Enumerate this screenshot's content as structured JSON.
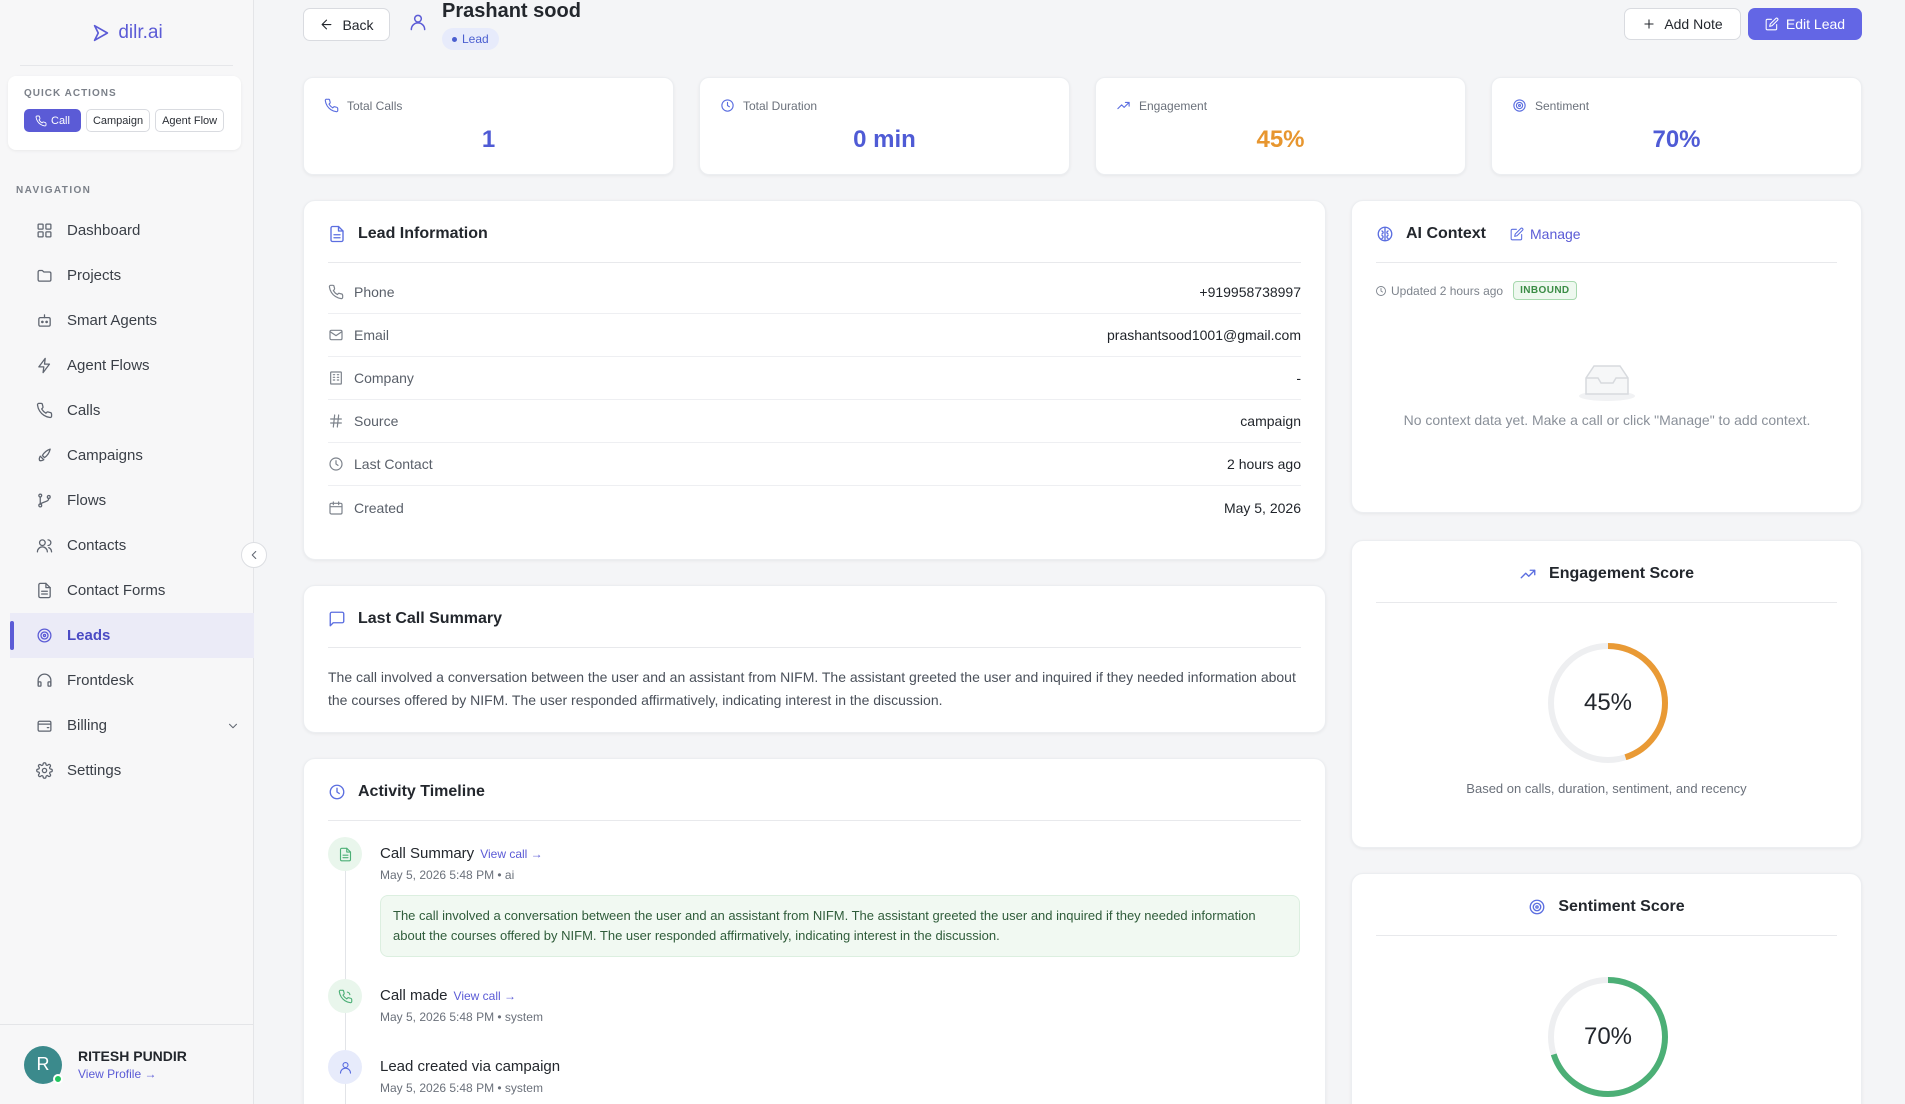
{
  "app": {
    "logo_text": "dilr.ai"
  },
  "quick_actions": {
    "title": "QUICK ACTIONS",
    "call": "Call",
    "campaign": "Campaign",
    "agent_flow": "Agent Flow"
  },
  "nav": {
    "title": "NAVIGATION",
    "items": [
      {
        "label": "Dashboard",
        "icon": "dashboard-icon"
      },
      {
        "label": "Projects",
        "icon": "folder-icon"
      },
      {
        "label": "Smart Agents",
        "icon": "bot-icon"
      },
      {
        "label": "Agent Flows",
        "icon": "zap-icon"
      },
      {
        "label": "Calls",
        "icon": "phone-icon"
      },
      {
        "label": "Campaigns",
        "icon": "rocket-icon"
      },
      {
        "label": "Flows",
        "icon": "git-branch-icon"
      },
      {
        "label": "Contacts",
        "icon": "users-icon"
      },
      {
        "label": "Contact Forms",
        "icon": "form-icon"
      },
      {
        "label": "Leads",
        "icon": "target-icon"
      },
      {
        "label": "Frontdesk",
        "icon": "headphones-icon"
      },
      {
        "label": "Billing",
        "icon": "wallet-icon"
      },
      {
        "label": "Settings",
        "icon": "gear-icon"
      }
    ],
    "active": "Leads"
  },
  "user": {
    "initial": "R",
    "name": "RITESH PUNDIR",
    "link": "View Profile →"
  },
  "header": {
    "back": "Back",
    "lead_name": "Prashant sood",
    "badge": "Lead",
    "add_note": "Add Note",
    "edit_lead": "Edit Lead"
  },
  "stats": [
    {
      "label": "Total Calls",
      "value": "1",
      "color": "#4f5bd5"
    },
    {
      "label": "Total Duration",
      "value": "0 min",
      "color": "#4f5bd5"
    },
    {
      "label": "Engagement",
      "value": "45%",
      "color": "#e7962f"
    },
    {
      "label": "Sentiment",
      "value": "70%",
      "color": "#4f5bd5"
    }
  ],
  "lead_info": {
    "title": "Lead Information",
    "rows": [
      {
        "label": "Phone",
        "value": "+919958738997"
      },
      {
        "label": "Email",
        "value": "prashantsood1001@gmail.com"
      },
      {
        "label": "Company",
        "value": "-"
      },
      {
        "label": "Source",
        "value": "campaign"
      },
      {
        "label": "Last Contact",
        "value": "2 hours ago"
      },
      {
        "label": "Created",
        "value": "May 5, 2026"
      }
    ]
  },
  "last_call": {
    "title": "Last Call Summary",
    "text": "The call involved a conversation between the user and an assistant from NIFM. The assistant greeted the user and inquired if they needed information about the courses offered by NIFM. The user responded affirmatively, indicating interest in the discussion."
  },
  "timeline": {
    "title": "Activity Timeline",
    "items": [
      {
        "title": "Call Summary",
        "link": "View call →",
        "meta": "May 5, 2026 5:48 PM • ai",
        "text": "The call involved a conversation between the user and an assistant from NIFM. The assistant greeted the user and inquired if they needed information about the courses offered by NIFM. The user responded affirmatively, indicating interest in the discussion."
      },
      {
        "title": "Call made",
        "link": "View call →",
        "meta": "May 5, 2026 5:48 PM • system"
      },
      {
        "title": "Lead created via campaign",
        "meta": "May 5, 2026 5:48 PM • system"
      }
    ]
  },
  "ai_context": {
    "title": "AI Context",
    "manage": "Manage",
    "updated": "Updated 2 hours ago",
    "tag": "INBOUND",
    "empty": "No context data yet. Make a call or click \"Manage\" to add context."
  },
  "engagement_score": {
    "title": "Engagement Score",
    "value": "45%",
    "fraction": 0.45,
    "color": "#e99a35",
    "subtitle": "Based on calls, duration, sentiment, and recency"
  },
  "sentiment_score": {
    "title": "Sentiment Score",
    "value": "70%",
    "fraction": 0.7,
    "color": "#4caf76"
  }
}
